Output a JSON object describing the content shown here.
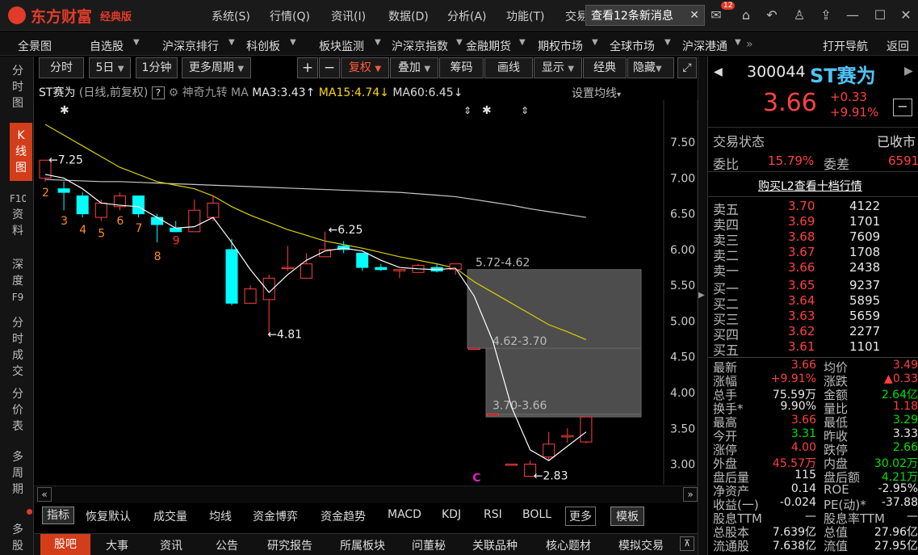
{
  "app": {
    "name": "东方财富",
    "edition": "经典版"
  },
  "top_menu": [
    "系统(S)",
    "行情(Q)",
    "资讯(I)",
    "数据(D)",
    "分析(A)",
    "功能(T)",
    "交易"
  ],
  "message": {
    "text": "查看12条新消息",
    "badge": "12"
  },
  "nav": [
    "全景图",
    "自选股",
    "沪深京排行",
    "科创板",
    "板块监测",
    "沪深京指数",
    "金融期货",
    "期权市场",
    "全球市场",
    "沪深港通"
  ],
  "nav_right": [
    "打开导航",
    "返回"
  ],
  "sidebar_tabs": [
    "分时图",
    "K线图",
    "F10资料",
    "深度F9",
    "分时成交",
    "分价表",
    "多周期",
    "多股"
  ],
  "chart_toolbar": {
    "period_btns": [
      "分时",
      "5日",
      "1分钟",
      "更多周期"
    ],
    "plus": "+",
    "minus": "−",
    "tools": [
      "复权",
      "叠加",
      "筹码",
      "画线",
      "显示",
      "经典",
      "隐藏"
    ]
  },
  "ma_line": {
    "stock": "ST赛为",
    "mode": "(日线,前复权)",
    "q": "?",
    "magic": "神奇九转",
    "ma": "MA",
    "ma3": "MA3:3.43",
    "ma15": "MA15:4.74",
    "ma60": "MA60:6.45",
    "settings": "设置均线"
  },
  "chart_data": {
    "type": "candlestick",
    "y_ticks": [
      "7.50",
      "7.00",
      "6.50",
      "6.00",
      "5.50",
      "5.00",
      "4.50",
      "4.00",
      "3.50",
      "3.00"
    ],
    "ylim": [
      2.78,
      7.75
    ],
    "candles": [
      {
        "o": 7.0,
        "h": 7.25,
        "l": 6.95,
        "c": 7.25
      },
      {
        "o": 6.85,
        "h": 6.95,
        "l": 6.55,
        "c": 6.8
      },
      {
        "o": 6.75,
        "h": 6.8,
        "l": 6.45,
        "c": 6.5
      },
      {
        "o": 6.45,
        "h": 6.7,
        "l": 6.4,
        "c": 6.65
      },
      {
        "o": 6.6,
        "h": 6.8,
        "l": 6.55,
        "c": 6.75
      },
      {
        "o": 6.75,
        "h": 6.75,
        "l": 6.45,
        "c": 6.5
      },
      {
        "o": 6.45,
        "h": 6.5,
        "l": 6.1,
        "c": 6.35
      },
      {
        "o": 6.3,
        "h": 6.4,
        "l": 6.3,
        "c": 6.25
      },
      {
        "o": 6.25,
        "h": 6.7,
        "l": 6.25,
        "c": 6.55
      },
      {
        "o": 6.45,
        "h": 6.75,
        "l": 6.4,
        "c": 6.65
      },
      {
        "o": 6.0,
        "h": 6.15,
        "l": 5.22,
        "c": 5.25
      },
      {
        "o": 5.25,
        "h": 5.5,
        "l": 5.25,
        "c": 5.45
      },
      {
        "o": 5.3,
        "h": 5.65,
        "l": 4.81,
        "c": 5.6
      },
      {
        "o": 5.75,
        "h": 6.05,
        "l": 5.7,
        "c": 5.75
      },
      {
        "o": 5.6,
        "h": 5.95,
        "l": 5.6,
        "c": 5.8
      },
      {
        "o": 5.9,
        "h": 6.25,
        "l": 5.9,
        "c": 6.0
      },
      {
        "o": 6.05,
        "h": 6.12,
        "l": 5.95,
        "c": 6.0
      },
      {
        "o": 5.95,
        "h": 5.95,
        "l": 5.7,
        "c": 5.75
      },
      {
        "o": 5.75,
        "h": 5.8,
        "l": 5.7,
        "c": 5.72
      },
      {
        "o": 5.72,
        "h": 5.72,
        "l": 5.6,
        "c": 5.72
      },
      {
        "o": 5.68,
        "h": 5.8,
        "l": 5.68,
        "c": 5.78
      },
      {
        "o": 5.75,
        "h": 5.8,
        "l": 5.68,
        "c": 5.7
      },
      {
        "o": 5.72,
        "h": 5.8,
        "l": 5.65,
        "c": 5.8
      },
      {
        "o": 4.62,
        "h": 4.62,
        "l": 4.62,
        "c": 4.62
      },
      {
        "o": 3.7,
        "h": 3.7,
        "l": 3.7,
        "c": 3.7
      },
      {
        "o": 3.0,
        "h": 3.0,
        "l": 3.0,
        "c": 3.0
      },
      {
        "o": 2.83,
        "h": 3.05,
        "l": 2.83,
        "c": 3.0
      },
      {
        "o": 3.1,
        "h": 3.45,
        "l": 3.05,
        "c": 3.28
      },
      {
        "o": 3.38,
        "h": 3.5,
        "l": 3.3,
        "c": 3.4
      },
      {
        "o": 3.31,
        "h": 3.66,
        "l": 3.29,
        "c": 3.66
      }
    ],
    "ma3": [
      7.05,
      7.0,
      6.85,
      6.65,
      6.62,
      6.6,
      6.45,
      6.3,
      6.32,
      6.45,
      6.1,
      5.72,
      5.4,
      5.65,
      5.85,
      5.98,
      6.02,
      5.98,
      5.85,
      5.75,
      5.73,
      5.72,
      5.74,
      5.35,
      4.72,
      3.8,
      3.2,
      3.05,
      3.25,
      3.45
    ],
    "ma15": [
      7.75,
      7.6,
      7.45,
      7.3,
      7.15,
      7.05,
      6.95,
      6.9,
      6.85,
      6.75,
      6.6,
      6.48,
      6.38,
      6.28,
      6.2,
      6.12,
      6.07,
      6.02,
      5.96,
      5.9,
      5.85,
      5.8,
      5.74,
      5.55,
      5.4,
      5.25,
      5.1,
      4.95,
      4.85,
      4.74
    ],
    "ma60": [
      6.98,
      6.97,
      6.96,
      6.95,
      6.95,
      6.94,
      6.93,
      6.92,
      6.91,
      6.9,
      6.89,
      6.88,
      6.87,
      6.86,
      6.85,
      6.84,
      6.83,
      6.82,
      6.81,
      6.8,
      6.78,
      6.76,
      6.74,
      6.7,
      6.66,
      6.62,
      6.57,
      6.53,
      6.49,
      6.45
    ],
    "labels": {
      "high": "7.25",
      "mid": "6.25",
      "low1": "4.81",
      "low2": "2.83"
    },
    "nine_turn": [
      "2",
      "3",
      "4",
      "5",
      "6",
      "7",
      "8",
      "9"
    ],
    "gaps": [
      {
        "label": "5.72-4.62",
        "top": 5.72,
        "bottom": 4.62
      },
      {
        "label": "4.62-3.70",
        "top": 4.62,
        "bottom": 3.7
      },
      {
        "label": "3.70-3.66",
        "top": 3.7,
        "bottom": 3.66
      }
    ],
    "marker": "C"
  },
  "indicators": [
    "指标",
    "恢复默认",
    "成交量",
    "均线",
    "资金博弈",
    "资金趋势",
    "MACD",
    "KDJ",
    "RSI",
    "BOLL",
    "更多",
    "模板"
  ],
  "bottom_tabs": [
    "股吧",
    "大事",
    "资讯",
    "公告",
    "研究报告",
    "所属板块",
    "问董秘",
    "关联品种",
    "核心题材",
    "模拟交易"
  ],
  "quote": {
    "code": "300044",
    "name": "ST赛为",
    "price": "3.66",
    "change": "+0.33",
    "pct": "+9.91%",
    "status_label": "交易状态",
    "status": "已收市",
    "weibi_label": "委比",
    "weibi": "15.79%",
    "weicha_label": "委差",
    "weicha": "6591",
    "l2": "购买L2查看十档行情",
    "asks": [
      {
        "label": "卖五",
        "price": "3.70",
        "vol": "4122"
      },
      {
        "label": "卖四",
        "price": "3.69",
        "vol": "1701"
      },
      {
        "label": "卖三",
        "price": "3.68",
        "vol": "7609"
      },
      {
        "label": "卖二",
        "price": "3.67",
        "vol": "1708"
      },
      {
        "label": "卖一",
        "price": "3.66",
        "vol": "2438"
      }
    ],
    "bids": [
      {
        "label": "买一",
        "price": "3.65",
        "vol": "9237"
      },
      {
        "label": "买二",
        "price": "3.64",
        "vol": "5895"
      },
      {
        "label": "买三",
        "price": "3.63",
        "vol": "5659"
      },
      {
        "label": "买四",
        "price": "3.62",
        "vol": "2277"
      },
      {
        "label": "买五",
        "price": "3.61",
        "vol": "1101"
      }
    ],
    "stats": [
      {
        "l1": "最新",
        "v1": "3.66",
        "c1": "red",
        "l2": "均价",
        "v2": "3.49",
        "c2": "red"
      },
      {
        "l1": "涨幅",
        "v1": "+9.91%",
        "c1": "red",
        "l2": "涨跌",
        "v2": "▲0.33",
        "c2": "red"
      },
      {
        "l1": "总手",
        "v1": "75.59万",
        "c1": "white",
        "l2": "金额",
        "v2": "2.64亿",
        "c2": "green"
      },
      {
        "l1": "换手*",
        "v1": "9.90%",
        "c1": "white",
        "l2": "量比",
        "v2": "1.18",
        "c2": "red"
      },
      {
        "l1": "最高",
        "v1": "3.66",
        "c1": "red",
        "l2": "最低",
        "v2": "3.29",
        "c2": "green"
      },
      {
        "l1": "今开",
        "v1": "3.31",
        "c1": "green",
        "l2": "昨收",
        "v2": "3.33",
        "c2": "white"
      },
      {
        "l1": "涨停",
        "v1": "4.00",
        "c1": "red",
        "l2": "跌停",
        "v2": "2.66",
        "c2": "green"
      },
      {
        "l1": "外盘",
        "v1": "45.57万",
        "c1": "red",
        "l2": "内盘",
        "v2": "30.02万",
        "c2": "green"
      },
      {
        "l1": "盘后量",
        "v1": "115",
        "c1": "white",
        "l2": "盘后额",
        "v2": "4.21万",
        "c2": "green"
      },
      {
        "l1": "净资产",
        "v1": "0.14",
        "c1": "white",
        "l2": "ROE",
        "v2": "-2.95%",
        "c2": "white"
      },
      {
        "l1": "收益(一)",
        "v1": "-0.024",
        "c1": "white",
        "l2": "PE(动)*",
        "v2": "-37.88",
        "c2": "white"
      },
      {
        "l1": "股息TTM",
        "v1": "—",
        "c1": "white",
        "l2": "股息率TTM",
        "v2": "—",
        "c2": "white"
      },
      {
        "l1": "总股本",
        "v1": "7.639亿",
        "c1": "white",
        "l2": "总值",
        "v2": "27.96亿",
        "c2": "white"
      },
      {
        "l1": "流通股",
        "v1": "7.638亿",
        "c1": "white",
        "l2": "流值",
        "v2": "27.95亿",
        "c2": "white"
      }
    ]
  },
  "colors": {
    "up": "#ff4040",
    "down": "#00ffff",
    "ma3": "#ffffff",
    "ma15": "#d8d000",
    "ma60": "#c8c8c8",
    "accent": "#d43d1a"
  }
}
